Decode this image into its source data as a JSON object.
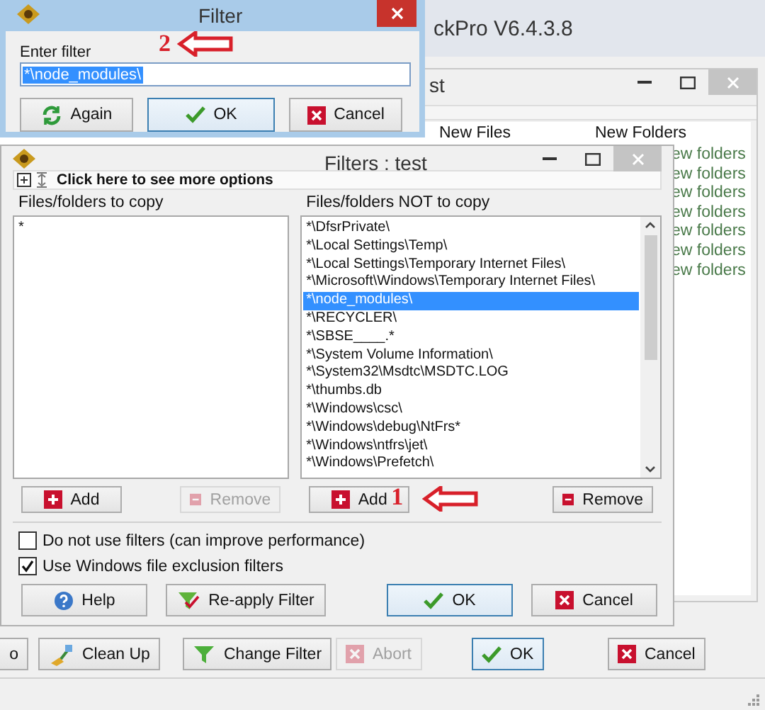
{
  "main_window": {
    "title": "ckPro V6.4.3.8",
    "buttons": [
      {
        "label": "o",
        "kind": "none",
        "disabled": false,
        "default": false
      },
      {
        "label": "Clean Up",
        "kind": "cleanup",
        "disabled": false,
        "default": false
      },
      {
        "label": "Change Filter",
        "kind": "funnel",
        "disabled": false,
        "default": false
      },
      {
        "label": "Abort",
        "kind": "cross",
        "disabled": true,
        "default": false
      },
      {
        "label": "OK",
        "kind": "check",
        "disabled": false,
        "default": true
      },
      {
        "label": "Cancel",
        "kind": "cross",
        "disabled": false,
        "default": false
      }
    ]
  },
  "project_window": {
    "title": "st",
    "columns": [
      "New Files",
      "New Folders"
    ],
    "rows": [
      "ew folders",
      "ew folders",
      "ew folders",
      "ew folders",
      "ew folders",
      "ew folders",
      "ew folders"
    ]
  },
  "filters_dialog": {
    "title": "Filters : test",
    "options_link": "Click here to see more options",
    "copy_label": "Files/folders to copy",
    "copy_items": [
      {
        "text": "*",
        "selected": false
      }
    ],
    "copy_buttons": [
      {
        "label": "Add",
        "kind": "plus",
        "disabled": false,
        "default": false
      },
      {
        "label": "Remove",
        "kind": "minus",
        "disabled": true,
        "default": false
      }
    ],
    "exclude_label": "Files/folders NOT to copy",
    "exclude_items": [
      {
        "text": "*\\DfsrPrivate\\",
        "selected": false
      },
      {
        "text": "*\\Local Settings\\Temp\\",
        "selected": false
      },
      {
        "text": "*\\Local Settings\\Temporary Internet Files\\",
        "selected": false
      },
      {
        "text": "*\\Microsoft\\Windows\\Temporary Internet Files\\",
        "selected": false
      },
      {
        "text": "*\\node_modules\\",
        "selected": true
      },
      {
        "text": "*\\RECYCLER\\",
        "selected": false
      },
      {
        "text": "*\\SBSE____.*",
        "selected": false
      },
      {
        "text": "*\\System Volume Information\\",
        "selected": false
      },
      {
        "text": "*\\System32\\Msdtc\\MSDTC.LOG",
        "selected": false
      },
      {
        "text": "*\\thumbs.db",
        "selected": false
      },
      {
        "text": "*\\Windows\\csc\\",
        "selected": false
      },
      {
        "text": "*\\Windows\\debug\\NtFrs*",
        "selected": false
      },
      {
        "text": "*\\Windows\\ntfrs\\jet\\",
        "selected": false
      },
      {
        "text": "*\\Windows\\Prefetch\\",
        "selected": false
      }
    ],
    "exclude_buttons": [
      {
        "label": "Add",
        "kind": "plus",
        "disabled": false,
        "default": false
      },
      {
        "label": "Remove",
        "kind": "minus",
        "disabled": false,
        "default": false
      }
    ],
    "annotation": "1",
    "checkboxes": [
      {
        "label": "Do not use filters (can improve performance)",
        "checked": false
      },
      {
        "label": "Use Windows file exclusion filters",
        "checked": true
      }
    ],
    "buttons": [
      {
        "label": "Help",
        "kind": "help",
        "disabled": false,
        "default": false
      },
      {
        "label": "Re-apply Filter",
        "kind": "reapply",
        "disabled": false,
        "default": false
      },
      {
        "label": "OK",
        "kind": "check",
        "disabled": false,
        "default": true
      },
      {
        "label": "Cancel",
        "kind": "cross",
        "disabled": false,
        "default": false
      }
    ]
  },
  "filter_dialog": {
    "title": "Filter",
    "annotation": "2",
    "label": "Enter filter",
    "value": "*\\node_modules\\",
    "value_selected": true,
    "buttons": [
      {
        "label": "Again",
        "kind": "refresh",
        "disabled": false,
        "default": false
      },
      {
        "label": "OK",
        "kind": "check",
        "disabled": false,
        "default": true
      },
      {
        "label": "Cancel",
        "kind": "cross",
        "disabled": false,
        "default": false
      }
    ]
  }
}
